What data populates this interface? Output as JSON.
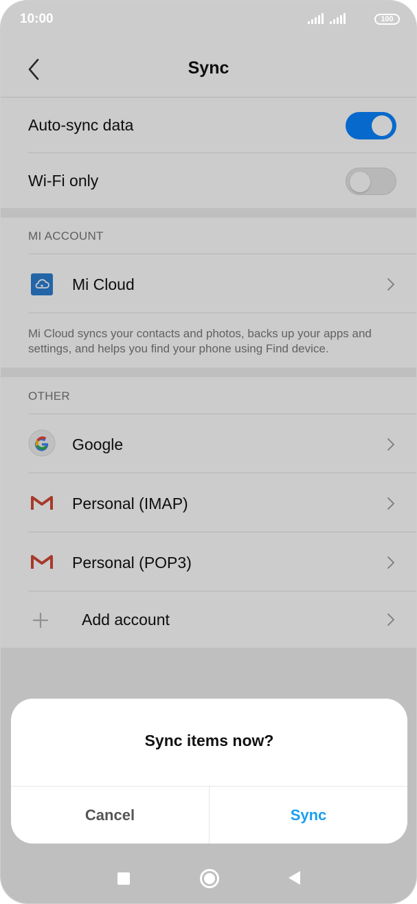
{
  "status_bar": {
    "time": "10:00",
    "battery": "100"
  },
  "header": {
    "title": "Sync"
  },
  "toggles": [
    {
      "label": "Auto-sync data",
      "state": "on"
    },
    {
      "label": "Wi-Fi only",
      "state": "off"
    }
  ],
  "mi_account": {
    "section_label": "MI ACCOUNT",
    "item_label": "Mi Cloud",
    "icon": "mi-cloud-icon",
    "footnote": "Mi Cloud syncs your contacts and photos, backs up your apps and settings, and helps you find your phone using Find device."
  },
  "other": {
    "section_label": "OTHER",
    "items": [
      {
        "label": "Google",
        "icon": "google-icon"
      },
      {
        "label": "Personal (IMAP)",
        "icon": "gmail-icon"
      },
      {
        "label": "Personal (POP3)",
        "icon": "gmail-icon"
      },
      {
        "label": "Add account",
        "icon": "plus-icon"
      }
    ]
  },
  "dialog": {
    "title": "Sync items now?",
    "cancel_label": "Cancel",
    "confirm_label": "Sync"
  },
  "colors": {
    "accent": "#0a84ff",
    "dialog_confirm": "#1a9ef0",
    "overlay": "rgba(0,0,0,0.2)"
  }
}
